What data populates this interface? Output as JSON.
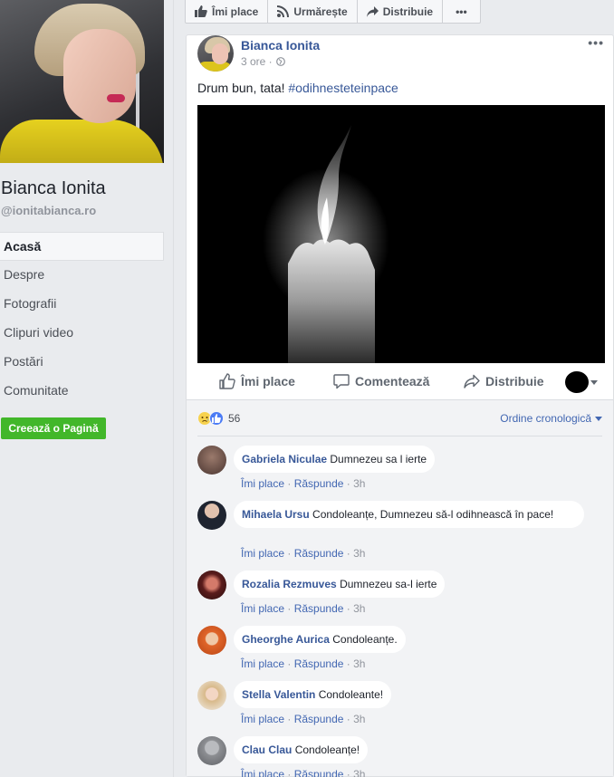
{
  "sidebar": {
    "profile_name": "Bianca Ionita",
    "profile_handle": "@ionitabianca.ro",
    "nav": [
      {
        "label": "Acasă"
      },
      {
        "label": "Despre"
      },
      {
        "label": "Fotografii"
      },
      {
        "label": "Clipuri video"
      },
      {
        "label": "Postări"
      },
      {
        "label": "Comunitate"
      }
    ],
    "create_page_label": "Creează o Pagină"
  },
  "top_actions": {
    "like_label": "Îmi place",
    "follow_label": "Urmărește",
    "share_label": "Distribuie",
    "more_label": "•••"
  },
  "post": {
    "author": "Bianca Ionita",
    "time": "3 ore ·",
    "privacy_icon": "globe-icon",
    "options_label": "•••",
    "text": "Drum bun, tata! ",
    "hashtag": "#odihnesteteinpace",
    "image_description_icon": "candle-icon",
    "actions": {
      "like": "Îmi place",
      "comment": "Comentează",
      "share": "Distribuie"
    }
  },
  "reactions": {
    "icons": [
      "sad-reaction-icon",
      "like-reaction-icon"
    ],
    "count": "56",
    "sort_label": "Ordine cronologică"
  },
  "comments": [
    {
      "name": "Gabriela Niculae",
      "text": "Dumnezeu sa l ierte",
      "text2": "",
      "like": "Îmi place",
      "reply": "Răspunde",
      "time": "3h",
      "avatar_color": "#6b4f47"
    },
    {
      "name": "Mihaela Ursu",
      "text": "Condoleanțe, Dumnezeu să-l odihnească în",
      "text2": "pace!",
      "like": "Îmi place",
      "reply": "Răspunde",
      "time": "3h",
      "avatar_color": "#2a2a33"
    },
    {
      "name": "Rozalia Rezmuves",
      "text": "Dumnezeu sa-l ierte",
      "text2": "",
      "like": "Îmi place",
      "reply": "Răspunde",
      "time": "3h",
      "avatar_color": "#7a2a2a"
    },
    {
      "name": "Gheorghe Aurica",
      "text": "Condoleanțe.",
      "text2": "",
      "like": "Îmi place",
      "reply": "Răspunde",
      "time": "3h",
      "avatar_color": "#e0652a"
    },
    {
      "name": "Stella Valentin",
      "text": "Condoleante!",
      "text2": "",
      "like": "Îmi place",
      "reply": "Răspunde",
      "time": "3h",
      "avatar_color": "#d8c3a3"
    },
    {
      "name": "Clau Clau",
      "text": "Condoleanțe!",
      "text2": "",
      "like": "Îmi place",
      "reply": "Răspunde",
      "time": "3h",
      "avatar_color": "#8d8f93"
    }
  ]
}
